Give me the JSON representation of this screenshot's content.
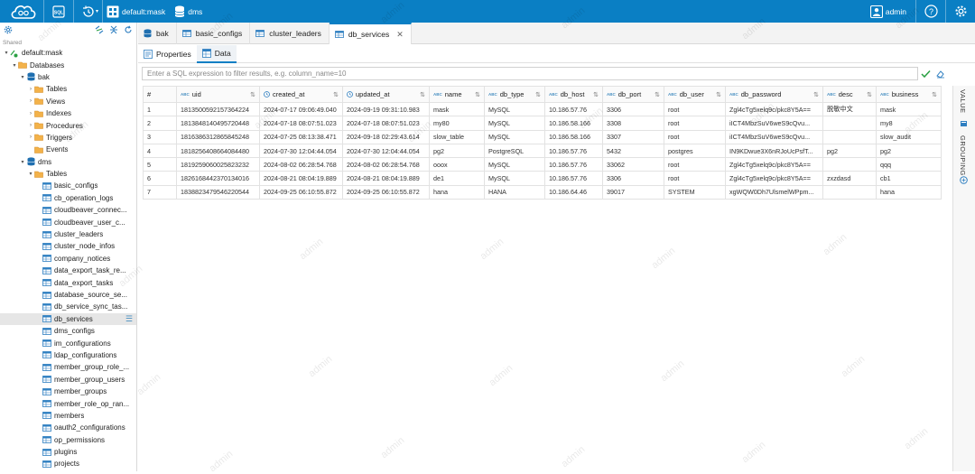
{
  "topbar": {
    "connection_label": "default:mask",
    "database_label": "dms",
    "user_label": "admin"
  },
  "sidebar": {
    "shared_label": "Shared",
    "tree": [
      {
        "label": "default:mask",
        "depth": 0,
        "arrow": "▾",
        "icon": "connection-icon"
      },
      {
        "label": "Databases",
        "depth": 1,
        "arrow": "▾",
        "icon": "folder-icon"
      },
      {
        "label": "bak",
        "depth": 2,
        "arrow": "▾",
        "icon": "database-icon"
      },
      {
        "label": "Tables",
        "depth": 3,
        "arrow": "›",
        "icon": "folder-icon"
      },
      {
        "label": "Views",
        "depth": 3,
        "arrow": "›",
        "icon": "folder-icon"
      },
      {
        "label": "Indexes",
        "depth": 3,
        "arrow": "›",
        "icon": "folder-icon"
      },
      {
        "label": "Procedures",
        "depth": 3,
        "arrow": "›",
        "icon": "folder-icon"
      },
      {
        "label": "Triggers",
        "depth": 3,
        "arrow": "›",
        "icon": "folder-icon"
      },
      {
        "label": "Events",
        "depth": 3,
        "arrow": "",
        "icon": "folder-icon"
      },
      {
        "label": "dms",
        "depth": 2,
        "arrow": "▾",
        "icon": "database-icon"
      },
      {
        "label": "Tables",
        "depth": 3,
        "arrow": "▾",
        "icon": "folder-icon"
      },
      {
        "label": "basic_configs",
        "depth": 4,
        "arrow": "",
        "icon": "table-icon"
      },
      {
        "label": "cb_operation_logs",
        "depth": 4,
        "arrow": "",
        "icon": "table-icon"
      },
      {
        "label": "cloudbeaver_connec...",
        "depth": 4,
        "arrow": "",
        "icon": "table-icon"
      },
      {
        "label": "cloudbeaver_user_c...",
        "depth": 4,
        "arrow": "",
        "icon": "table-icon"
      },
      {
        "label": "cluster_leaders",
        "depth": 4,
        "arrow": "",
        "icon": "table-icon"
      },
      {
        "label": "cluster_node_infos",
        "depth": 4,
        "arrow": "",
        "icon": "table-icon"
      },
      {
        "label": "company_notices",
        "depth": 4,
        "arrow": "",
        "icon": "table-icon"
      },
      {
        "label": "data_export_task_re...",
        "depth": 4,
        "arrow": "",
        "icon": "table-icon"
      },
      {
        "label": "data_export_tasks",
        "depth": 4,
        "arrow": "",
        "icon": "table-icon"
      },
      {
        "label": "database_source_se...",
        "depth": 4,
        "arrow": "",
        "icon": "table-icon"
      },
      {
        "label": "db_service_sync_tas...",
        "depth": 4,
        "arrow": "",
        "icon": "table-icon"
      },
      {
        "label": "db_services",
        "depth": 4,
        "arrow": "",
        "icon": "table-icon",
        "selected": true
      },
      {
        "label": "dms_configs",
        "depth": 4,
        "arrow": "",
        "icon": "table-icon"
      },
      {
        "label": "im_configurations",
        "depth": 4,
        "arrow": "",
        "icon": "table-icon"
      },
      {
        "label": "ldap_configurations",
        "depth": 4,
        "arrow": "",
        "icon": "table-icon"
      },
      {
        "label": "member_group_role_...",
        "depth": 4,
        "arrow": "",
        "icon": "table-icon"
      },
      {
        "label": "member_group_users",
        "depth": 4,
        "arrow": "",
        "icon": "table-icon"
      },
      {
        "label": "member_groups",
        "depth": 4,
        "arrow": "",
        "icon": "table-icon"
      },
      {
        "label": "member_role_op_ran...",
        "depth": 4,
        "arrow": "",
        "icon": "table-icon"
      },
      {
        "label": "members",
        "depth": 4,
        "arrow": "",
        "icon": "table-icon"
      },
      {
        "label": "oauth2_configurations",
        "depth": 4,
        "arrow": "",
        "icon": "table-icon"
      },
      {
        "label": "op_permissions",
        "depth": 4,
        "arrow": "",
        "icon": "table-icon"
      },
      {
        "label": "plugins",
        "depth": 4,
        "arrow": "",
        "icon": "table-icon"
      },
      {
        "label": "projects",
        "depth": 4,
        "arrow": "",
        "icon": "table-icon"
      }
    ]
  },
  "tabs": [
    {
      "label": "bak",
      "icon": "database-icon"
    },
    {
      "label": "basic_configs",
      "icon": "table-icon"
    },
    {
      "label": "cluster_leaders",
      "icon": "table-icon"
    },
    {
      "label": "db_services",
      "icon": "table-icon",
      "active": true
    }
  ],
  "subtabs": [
    {
      "label": "Properties",
      "icon": "properties-icon"
    },
    {
      "label": "Data",
      "icon": "data-grid-icon",
      "active": true
    }
  ],
  "filter": {
    "placeholder": "Enter a SQL expression to filter results, e.g. column_name=10"
  },
  "grid": {
    "row_number_header": "#",
    "columns": [
      {
        "label": "uid",
        "type": "ABC"
      },
      {
        "label": "created_at",
        "type": "clock"
      },
      {
        "label": "updated_at",
        "type": "clock"
      },
      {
        "label": "name",
        "type": "ABC"
      },
      {
        "label": "db_type",
        "type": "ABC"
      },
      {
        "label": "db_host",
        "type": "ABC"
      },
      {
        "label": "db_port",
        "type": "ABC"
      },
      {
        "label": "db_user",
        "type": "ABC"
      },
      {
        "label": "db_password",
        "type": "ABC"
      },
      {
        "label": "desc",
        "type": "ABC"
      },
      {
        "label": "business",
        "type": "ABC"
      }
    ],
    "rows": [
      [
        "1",
        "1813500592157364224",
        "2024-07-17 09:06:49.040",
        "2024-09-19 09:31:10.983",
        "mask",
        "MySQL",
        "10.186.57.76",
        "3306",
        "root",
        "Zgl4cTg5xelq9c/pkc8Y5A==",
        "脱敏中文",
        "mask"
      ],
      [
        "2",
        "1813848140495720448",
        "2024-07-18 08:07:51.023",
        "2024-07-18 08:07:51.023",
        "my80",
        "MySQL",
        "10.186.58.166",
        "3308",
        "root",
        "iICT4MbzSuV6weS9cQvu...",
        "",
        "my8"
      ],
      [
        "3",
        "1816386312865845248",
        "2024-07-25 08:13:38.471",
        "2024-09-18 02:29:43.614",
        "slow_table",
        "MySQL",
        "10.186.58.166",
        "3307",
        "root",
        "iICT4MbzSuV6weS9cQvu...",
        "",
        "slow_audit"
      ],
      [
        "4",
        "1818256408664084480",
        "2024-07-30 12:04:44.054",
        "2024-07-30 12:04:44.054",
        "pg2",
        "PostgreSQL",
        "10.186.57.76",
        "5432",
        "postgres",
        "IN9KDwue3X6nRJoUcPsfT...",
        "pg2",
        "pg2"
      ],
      [
        "5",
        "1819259060025823232",
        "2024-08-02 06:28:54.768",
        "2024-08-02 06:28:54.768",
        "ooox",
        "MySQL",
        "10.186.57.76",
        "33062",
        "root",
        "Zgl4cTg5xelq9c/pkc8Y5A==",
        "",
        "qqq"
      ],
      [
        "6",
        "1826168442370134016",
        "2024-08-21 08:04:19.889",
        "2024-08-21 08:04:19.889",
        "de1",
        "MySQL",
        "10.186.57.76",
        "3306",
        "root",
        "Zgl4cTg5xelq9c/pkc8Y5A==",
        "zxzdasd",
        "cb1"
      ],
      [
        "7",
        "1838823479546220544",
        "2024-09-25 06:10:55.872",
        "2024-09-25 06:10:55.872",
        "hana",
        "HANA",
        "10.186.64.46",
        "39017",
        "SYSTEM",
        "xgWQW0Dh7UlsmelWPpm...",
        "",
        "hana"
      ]
    ]
  },
  "right_panel": {
    "value_label": "VALUE",
    "grouping_label": "GROUPING"
  },
  "watermark": "admin",
  "colors": {
    "brand": "#0a7fc4",
    "folder": "#e8a33d",
    "table": "#2f7fc1",
    "database": "#1f6fb0",
    "connected": "#2aa043"
  }
}
